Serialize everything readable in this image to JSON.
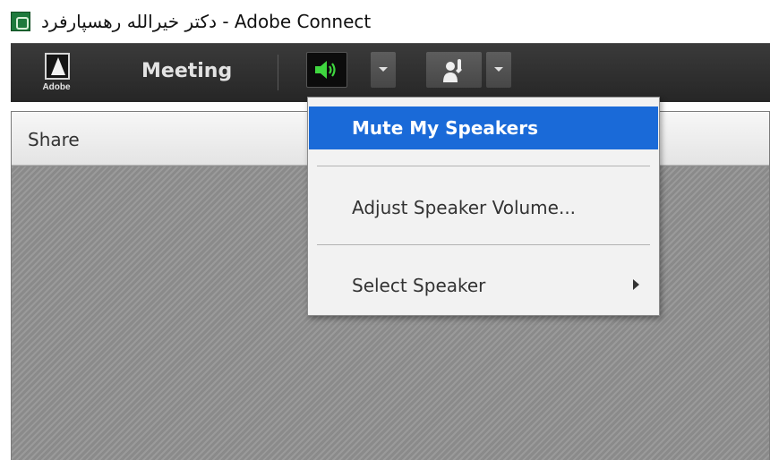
{
  "window": {
    "title": "دکتر خیرالله رهسپارفرد - Adobe Connect",
    "app_icon": "adobe-connect-app-icon"
  },
  "toolbar": {
    "logo_text": "Adobe",
    "logo_icon": "adobe-logo-icon",
    "meeting_label": "Meeting",
    "speaker_icon": "speaker-icon",
    "speaker_color": "#3fd63f",
    "camera_icon": "raise-hand-icon",
    "dropdown_icon": "chevron-down-icon"
  },
  "pod": {
    "title": "Share"
  },
  "menu": {
    "items": [
      {
        "label": "Mute My Speakers",
        "highlighted": true
      },
      {
        "label": "Adjust Speaker Volume...",
        "highlighted": false
      },
      {
        "label": "Select Speaker",
        "has_submenu": true
      }
    ],
    "highlight_color": "#1a6ad8"
  }
}
